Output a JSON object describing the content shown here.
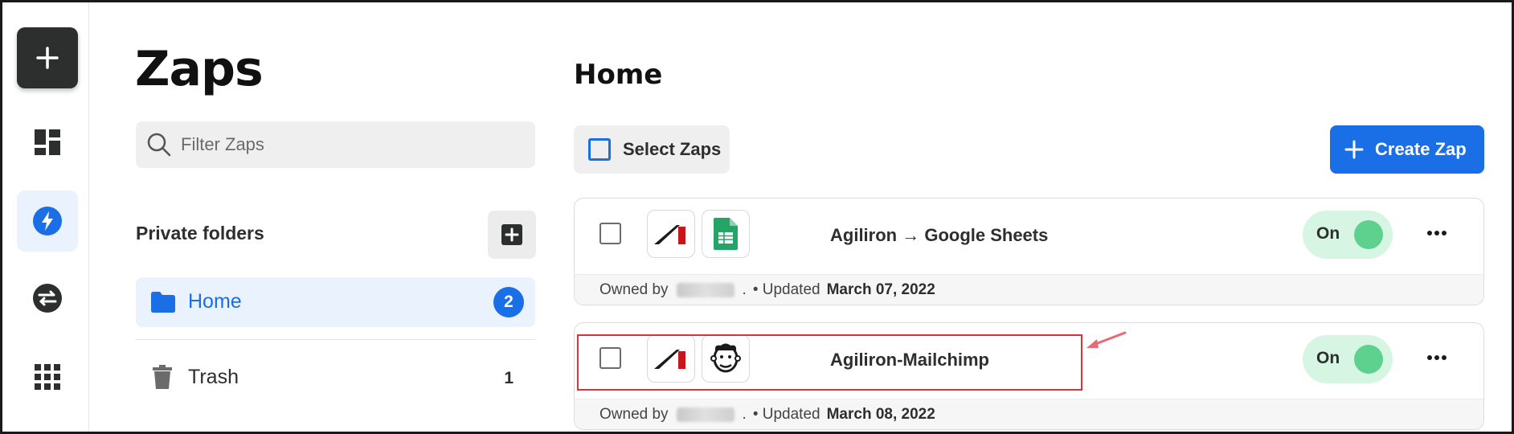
{
  "sidebar": {
    "create_icon": "plus-icon",
    "items": [
      {
        "name": "dashboard",
        "icon": "dashboard-icon"
      },
      {
        "name": "zaps",
        "icon": "lightning-icon",
        "active": true
      },
      {
        "name": "transfer",
        "icon": "transfer-icon"
      },
      {
        "name": "apps",
        "icon": "grid-icon"
      }
    ]
  },
  "folders": {
    "page_title": "Zaps",
    "filter_placeholder": "Filter Zaps",
    "section_title": "Private folders",
    "list": [
      {
        "label": "Home",
        "count": "2",
        "active": true,
        "icon": "folder-icon"
      },
      {
        "label": "Trash",
        "count": "1",
        "active": false,
        "icon": "trash-icon"
      }
    ]
  },
  "main": {
    "title": "Home",
    "select_label": "Select Zaps",
    "create_label": "Create Zap",
    "zaps": [
      {
        "name": "Agiliron → Google Sheets",
        "apps": [
          "agiliron",
          "google-sheets"
        ],
        "status": "On",
        "owned_by_label": "Owned by",
        "owner_suffix": ".",
        "updated_label": "• Updated",
        "updated_date": "March 07, 2022"
      },
      {
        "name": "Agiliron-Mailchimp",
        "apps": [
          "agiliron",
          "mailchimp"
        ],
        "status": "On",
        "owned_by_label": "Owned by",
        "owner_suffix": ".",
        "updated_label": "• Updated",
        "updated_date": "March 08, 2022"
      }
    ]
  },
  "colors": {
    "accent": "#1a6ee6",
    "toggle_on_bg": "#d6f5e3",
    "toggle_knob": "#5fd18e",
    "annotation": "#e0303a"
  }
}
